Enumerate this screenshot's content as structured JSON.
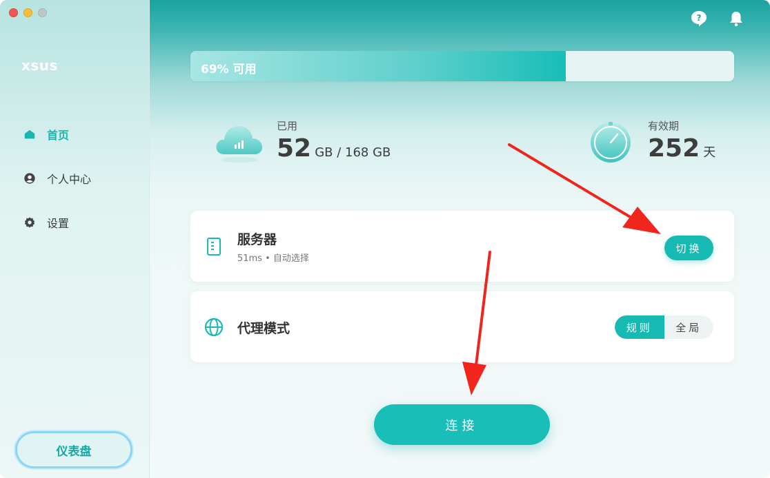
{
  "window": {
    "brand": "xsus"
  },
  "sidebar": {
    "items": [
      {
        "label": "首页",
        "icon": "home-icon",
        "active": true
      },
      {
        "label": "个人中心",
        "icon": "user-icon",
        "active": false
      },
      {
        "label": "设置",
        "icon": "gear-icon",
        "active": false
      }
    ],
    "dashboard_label": "仪表盘"
  },
  "header": {
    "icons": [
      "help-icon",
      "bell-icon"
    ]
  },
  "usage": {
    "text": "69% 可用",
    "available_percent": 69
  },
  "stats": {
    "used": {
      "label": "已用",
      "value": "52",
      "unit": "GB / 168 GB"
    },
    "validity": {
      "label": "有效期",
      "value": "252",
      "unit": "天"
    }
  },
  "server": {
    "title": "服务器",
    "subtitle": "51ms • 自动选择",
    "switch_label": "切换"
  },
  "proxy": {
    "title": "代理模式",
    "options": [
      "规则",
      "全局"
    ],
    "selected": "规则"
  },
  "connect_label": "连接",
  "colors": {
    "accent": "#17b9b3",
    "annotation": "#f0261d"
  }
}
